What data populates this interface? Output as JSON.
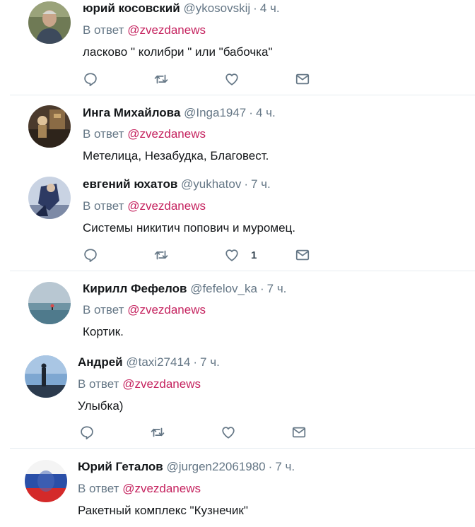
{
  "thread": {
    "reply_prefix": "В ответ",
    "tweets": [
      {
        "name": "юрий косовский",
        "handle": "@ykosovskij",
        "time": "4 ч.",
        "mention": "@zvezdanews",
        "text": "ласково \" колибри \" или \"бабочка\"",
        "likes": ""
      },
      {
        "name": "Инга Михайлова",
        "handle": "@Inga1947",
        "time": "4 ч.",
        "mention": "@zvezdanews",
        "text": "Метелица, Незабудка, Благовест.",
        "likes": ""
      },
      {
        "name": "евгений юхатов",
        "handle": "@yukhatov",
        "time": "7 ч.",
        "mention": "@zvezdanews",
        "text": "Системы никитич попович и муромец.",
        "likes": "1"
      },
      {
        "name": "Кирилл Фефелов",
        "handle": "@fefelov_ka",
        "time": "7 ч.",
        "mention": "@zvezdanews",
        "text": "Кортик.",
        "likes": ""
      },
      {
        "name": "Андрей",
        "handle": "@taxi27414",
        "time": "7 ч.",
        "mention": "@zvezdanews",
        "text": "Улыбка)",
        "likes": ""
      },
      {
        "name": "Юрий Геталов",
        "handle": "@jurgen22061980",
        "time": "7 ч.",
        "mention": "@zvezdanews",
        "text": "Ракетный комплекс \"Кузнечик\"",
        "likes": ""
      }
    ]
  },
  "icons": {
    "reply": "speech-bubble-icon",
    "retweet": "retweet-arrows-icon",
    "like": "heart-icon",
    "dm": "envelope-icon"
  },
  "colors": {
    "mention": "#c5235f",
    "secondary_text": "#657786",
    "divider": "#e6ecf0"
  }
}
